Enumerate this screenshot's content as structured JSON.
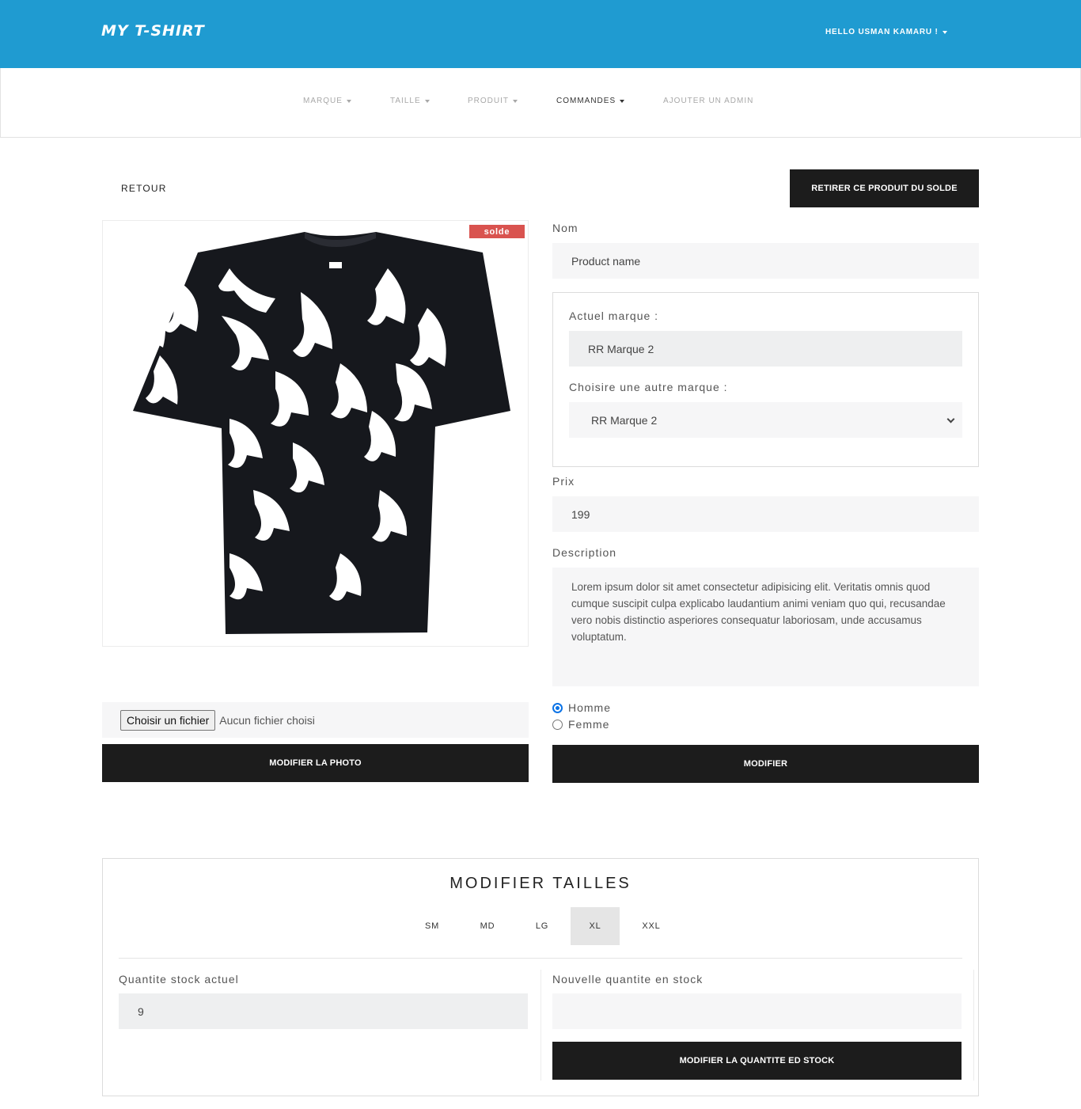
{
  "header": {
    "brand": "MY T-SHIRT",
    "user_greeting": "HELLO USMAN KAMARU !"
  },
  "nav": {
    "items": [
      {
        "label": "MARQUE",
        "dropdown": true
      },
      {
        "label": "TAILLE",
        "dropdown": true
      },
      {
        "label": "PRODUIT",
        "dropdown": true
      },
      {
        "label": "COMMANDES",
        "dropdown": true,
        "active": true
      },
      {
        "label": "AJOUTER UN ADMIN",
        "dropdown": false
      }
    ]
  },
  "actions": {
    "back_label": "RETOUR",
    "remove_sale_label": "RETIRER CE PRODUIT DU SOLDE"
  },
  "product": {
    "sale_badge": "solde",
    "image_alt": "black t-shirt with white swallow print",
    "file_button": "Choisir un fichier",
    "file_status": "Aucun fichier choisi",
    "update_photo_label": "MODIFIER LA PHOTO"
  },
  "form": {
    "name_label": "Nom",
    "name_value": "Product name",
    "current_brand_label": "Actuel marque :",
    "current_brand_value": "RR Marque 2",
    "choose_brand_label": "Choisire une autre marque :",
    "choose_brand_selected": "RR Marque 2",
    "price_label": "Prix",
    "price_value": "199",
    "description_label": "Description",
    "description_value": "Lorem ipsum dolor sit amet consectetur adipisicing elit. Veritatis omnis quod cumque suscipit culpa explicabo laudantium animi veniam quo qui, recusandae vero nobis distinctio asperiores consequatur laboriosam, unde accusamus voluptatum.",
    "gender_options": [
      {
        "label": "Homme",
        "checked": true
      },
      {
        "label": "Femme",
        "checked": false
      }
    ],
    "submit_label": "MODIFIER"
  },
  "sizes": {
    "title": "MODIFIER TAILLES",
    "tabs": [
      {
        "label": "SM",
        "active": false
      },
      {
        "label": "MD",
        "active": false
      },
      {
        "label": "LG",
        "active": false
      },
      {
        "label": "XL",
        "active": true
      },
      {
        "label": "XXL",
        "active": false
      }
    ],
    "current_stock_label": "Quantite stock actuel",
    "current_stock_value": "9",
    "new_stock_label": "Nouvelle quantite en stock",
    "new_stock_value": "",
    "update_stock_label": "MODIFIER LA QUANTITE ED STOCK"
  },
  "colors": {
    "header_blue": "#1f9bd1",
    "button_dark": "#1c1c1c",
    "badge_red": "#d9534f",
    "radio_blue": "#0b73e6"
  }
}
